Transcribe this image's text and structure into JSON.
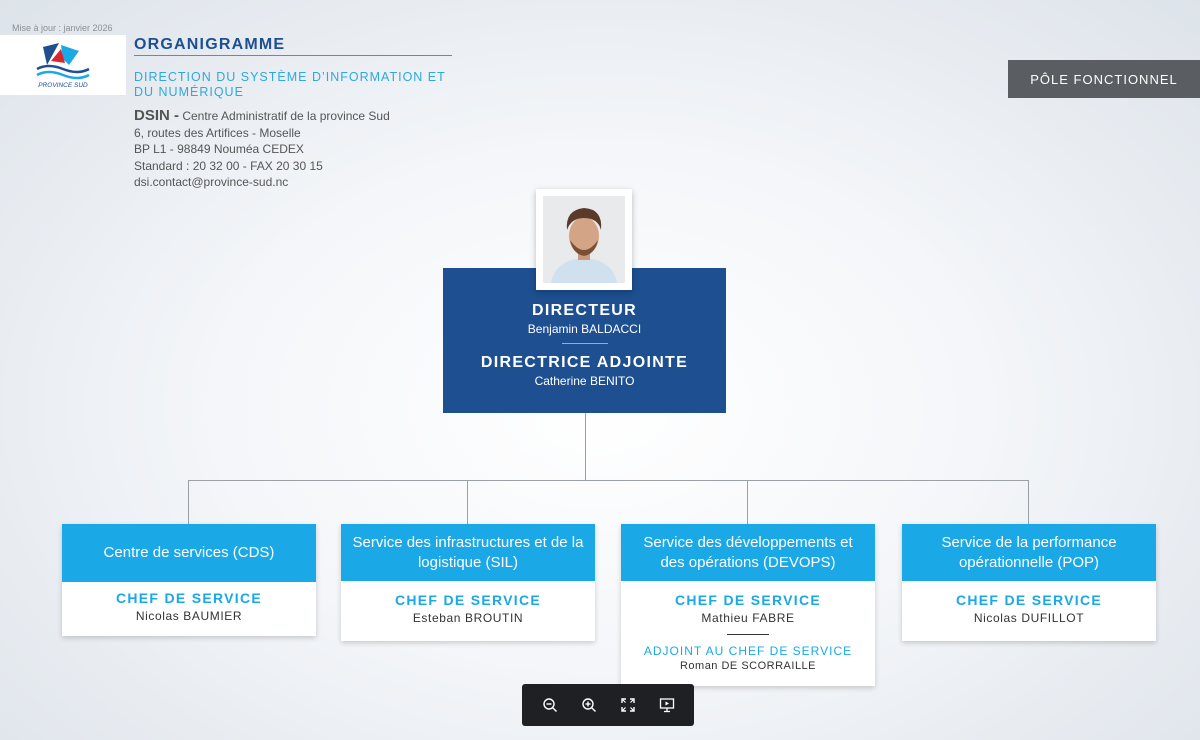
{
  "header": {
    "update_label": "Mise à jour :  janvier 2026",
    "title": "ORGANIGRAMME",
    "subtitle": "DIRECTION DU SYSTÈME D’INFORMATION ET DU NUMÉRIQUE",
    "logo_text": "PROVINCE SUD",
    "address": {
      "org": "DSIN -",
      "line1": " Centre Administratif de la province Sud",
      "line2": "6, routes des Artifices - Moselle",
      "line3": "BP L1 - 98849 Nouméa CEDEX",
      "line4": "Standard : 20 32 00 - FAX 20 30 15",
      "line5": "dsi.contact@province-sud.nc"
    },
    "pole_tag": "PÔLE FONCTIONNEL"
  },
  "direction": {
    "director_role": "DIRECTEUR",
    "director_name": "Benjamin BALDACCI",
    "deputy_role": "DIRECTRICE ADJOINTE",
    "deputy_name": "Catherine BENITO"
  },
  "services": [
    {
      "name": "Centre de services (CDS)",
      "chef_label": "CHEF DE SERVICE",
      "chef_name": "Nicolas BAUMIER"
    },
    {
      "name": "Service des infrastructures et de la logistique (SIL)",
      "chef_label": "CHEF DE SERVICE",
      "chef_name": "Esteban BROUTIN"
    },
    {
      "name": "Service des développements et des opérations (DEVOPS)",
      "chef_label": "CHEF DE SERVICE",
      "chef_name": "Mathieu FABRE",
      "adjoint_label": "ADJOINT AU CHEF DE SERVICE",
      "adjoint_name": "Roman DE SCORRAILLE"
    },
    {
      "name": "Service de la performance opérationnelle (POP)",
      "chef_label": "CHEF DE SERVICE",
      "chef_name": "Nicolas DUFILLOT"
    }
  ],
  "toolbar": {
    "icons": [
      "zoom-out-icon",
      "zoom-in-icon",
      "fullscreen-icon",
      "presentation-icon"
    ]
  },
  "colors": {
    "primary_blue": "#1d4f91",
    "service_blue": "#1aa8e6",
    "tag_gray": "#5a5d61"
  }
}
